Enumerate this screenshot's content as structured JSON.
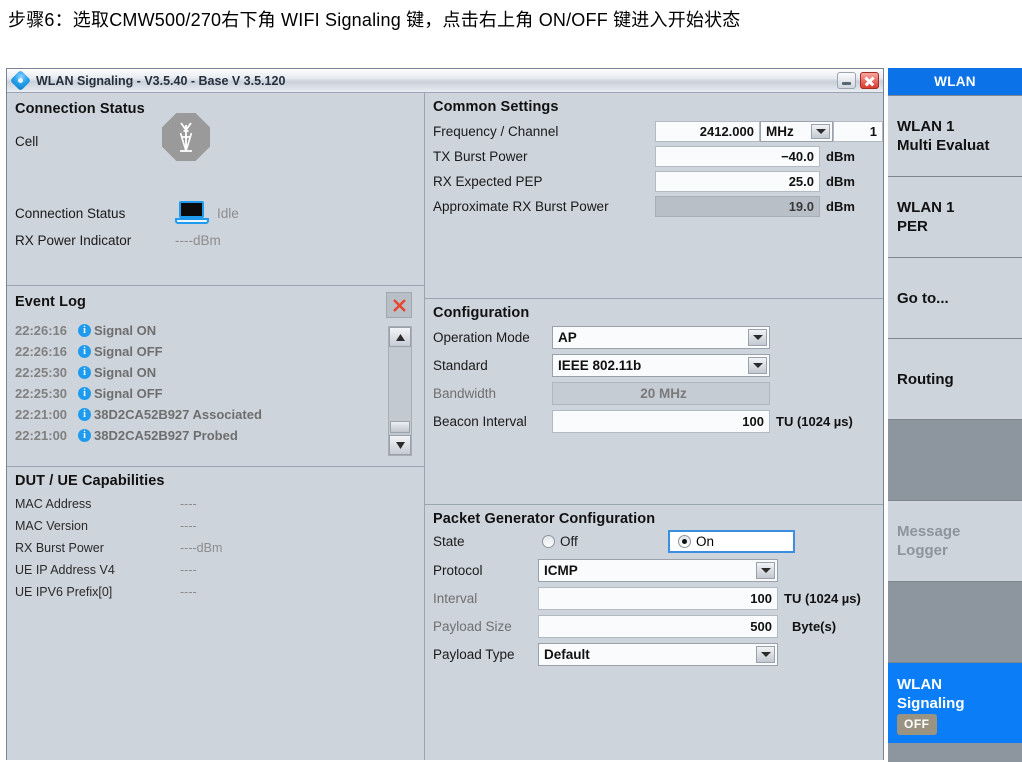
{
  "caption": "步骤6：选取CMW500/270右下角 WIFI Signaling 键，点击右上角 ON/OFF 键进入开始状态",
  "window": {
    "title": "WLAN Signaling  - V3.5.40 - Base V 3.5.120",
    "minimize_label": "–",
    "close_label": "✕"
  },
  "connection_status": {
    "title": "Connection Status",
    "cell_label": "Cell",
    "conn_label": "Connection Status",
    "conn_value": "Idle",
    "rx_label": "RX Power Indicator",
    "rx_value": "----dBm"
  },
  "event_log": {
    "title": "Event Log",
    "entries": [
      {
        "time": "22:26:16",
        "message": "Signal ON",
        "dim": false
      },
      {
        "time": "22:26:16",
        "message": "Signal OFF",
        "dim": false
      },
      {
        "time": "22:25:30",
        "message": "Signal ON",
        "dim": false
      },
      {
        "time": "22:25:30",
        "message": "Signal OFF",
        "dim": false
      },
      {
        "time": "22:21:00",
        "message": "38D2CA52B927 Associated",
        "dim": false
      },
      {
        "time": "22:21:00",
        "message": "38D2CA52B927 Probed",
        "dim": false
      }
    ]
  },
  "dut": {
    "title": "DUT / UE Capabilities",
    "rows": [
      {
        "key": "MAC Address",
        "value": "----"
      },
      {
        "key": "MAC Version",
        "value": "----"
      },
      {
        "key": "RX Burst Power",
        "value": "----dBm"
      },
      {
        "key": "UE IP Address V4",
        "value": "----"
      },
      {
        "key": "UE IPV6 Prefix[0]",
        "value": "----"
      }
    ]
  },
  "common_settings": {
    "title": "Common Settings",
    "frequency_label": "Frequency / Channel",
    "frequency_value": "2412.000",
    "frequency_unit": "MHz",
    "channel_value": "1",
    "tx_burst_label": "TX Burst Power",
    "tx_burst_value": "−40.0",
    "tx_burst_unit": "dBm",
    "rx_pep_label": "RX Expected PEP",
    "rx_pep_value": "25.0",
    "rx_pep_unit": "dBm",
    "approx_label": "Approximate RX Burst Power",
    "approx_value": "19.0",
    "approx_unit": "dBm"
  },
  "configuration": {
    "title": "Configuration",
    "operation_mode_label": "Operation Mode",
    "operation_mode_value": "AP",
    "standard_label": "Standard",
    "standard_value": "IEEE 802.11b",
    "bandwidth_label": "Bandwidth",
    "bandwidth_value": "20 MHz",
    "beacon_label": "Beacon Interval",
    "beacon_value": "100",
    "beacon_unit": "TU  (1024 µs)"
  },
  "packet_generator": {
    "title": "Packet Generator Configuration",
    "state_label": "State",
    "state_off_label": "Off",
    "state_on_label": "On",
    "state_selected": "On",
    "protocol_label": "Protocol",
    "protocol_value": "ICMP",
    "interval_label": "Interval",
    "interval_value": "100",
    "interval_unit": "TU  (1024 µs)",
    "payload_size_label": "Payload Size",
    "payload_size_value": "500",
    "payload_size_unit": "Byte(s)",
    "payload_type_label": "Payload Type",
    "payload_type_value": "Default"
  },
  "sidebar": {
    "header": "WLAN",
    "items": [
      {
        "label": "WLAN 1\nMulti Evaluat",
        "state": "normal"
      },
      {
        "label": "WLAN 1\nPER",
        "state": "normal"
      },
      {
        "label": "Go to...",
        "state": "normal"
      },
      {
        "label": "Routing",
        "state": "normal"
      },
      {
        "label": "",
        "state": "empty"
      },
      {
        "label": "Message\nLogger",
        "state": "disabled"
      },
      {
        "label": "",
        "state": "empty"
      },
      {
        "label": "WLAN\nSignaling",
        "state": "active",
        "badge": "OFF"
      }
    ]
  },
  "colors": {
    "accent_blue": "#0b7ef7",
    "panel_bg": "#ced4dc",
    "sidebar_bg": "#8d969f",
    "close_red": "#d83b30"
  }
}
